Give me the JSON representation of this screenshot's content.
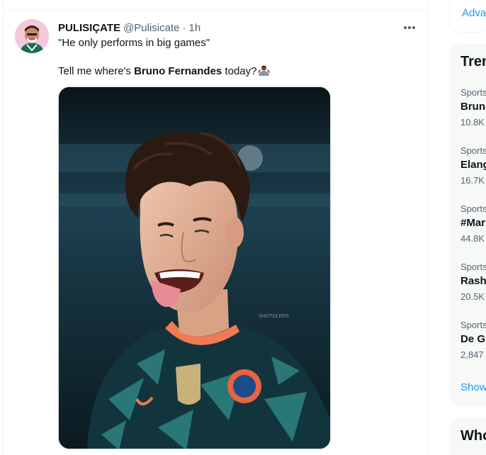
{
  "tweet": {
    "author_name": "PULISIÇATE",
    "author_handle": "@Pulisicate",
    "separator": "·",
    "time": "1h",
    "line1": "\"He only performs in big games\"",
    "line2_prefix": "Tell me where's ",
    "line2_bold": "Bruno Fernandes",
    "line2_suffix": " today?",
    "emoji_icon": "person-shrugging-emoji",
    "media_watermark": "SHOTDLEER"
  },
  "sidebar": {
    "advanced_label": "Adva",
    "trends_title": "Tren",
    "trends": [
      {
        "category": "Sports",
        "name": "Brune",
        "count": "10.8K"
      },
      {
        "category": "Sports",
        "name": "Elang",
        "count": "16.7K"
      },
      {
        "category": "Sports",
        "name": "#Mar",
        "count": "44.8K"
      },
      {
        "category": "Sports",
        "name": "Rash",
        "count": "20.5K"
      },
      {
        "category": "Sports",
        "name": "De G",
        "count": "2,847"
      }
    ],
    "show_more": "Show",
    "who_title": "Who"
  },
  "colors": {
    "accent": "#1d9bf0",
    "text_primary": "#0f1419",
    "text_secondary": "#536471",
    "border": "#eff3f4",
    "card_bg": "#f7f9f9"
  }
}
